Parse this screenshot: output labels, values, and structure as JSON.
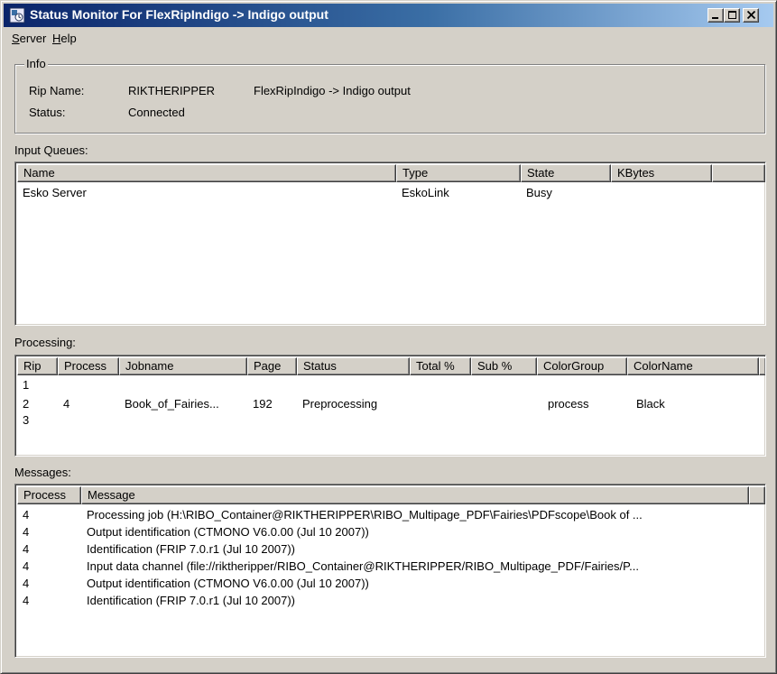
{
  "window": {
    "title": "Status Monitor For FlexRipIndigo -> Indigo output"
  },
  "menu": {
    "server": "Server",
    "server_rest": "erver",
    "server_key": "S",
    "help": "Help",
    "help_key": "H",
    "help_rest": "elp"
  },
  "info": {
    "legend": "Info",
    "rip_name_label": "Rip Name:",
    "rip_name_value": "RIKTHERIPPER",
    "rip_desc": "FlexRipIndigo -> Indigo output",
    "status_label": "Status:",
    "status_value": "Connected"
  },
  "input_queues": {
    "label": "Input Queues:",
    "columns": [
      "Name",
      "Type",
      "State",
      "KBytes"
    ],
    "rows": [
      [
        "Esko Server",
        "EskoLink",
        "Busy",
        ""
      ]
    ]
  },
  "processing": {
    "label": "Processing:",
    "columns": [
      "Rip",
      "Process",
      "Jobname",
      "Page",
      "Status",
      "Total %",
      "Sub %",
      "ColorGroup",
      "ColorName"
    ],
    "rows": [
      [
        "1",
        "",
        "",
        "",
        "",
        "",
        "",
        "",
        ""
      ],
      [
        "2",
        "4",
        "Book_of_Fairies...",
        "192",
        "Preprocessing",
        "",
        "",
        "process",
        "Black"
      ],
      [
        "3",
        "",
        "",
        "",
        "",
        "",
        "",
        "",
        ""
      ]
    ]
  },
  "messages": {
    "label": "Messages:",
    "columns": [
      "Process",
      "Message"
    ],
    "rows": [
      [
        "4",
        "Processing job (H:\\RIBO_Container@RIKTHERIPPER\\RIBO_Multipage_PDF\\Fairies\\PDFscope\\Book of ..."
      ],
      [
        "4",
        "Output identification (CTMONO V6.0.00 (Jul 10 2007))"
      ],
      [
        "4",
        "Identification (FRIP 7.0.r1 (Jul 10 2007))"
      ],
      [
        "4",
        "Input data channel (file://riktheripper/RIBO_Container@RIKTHERIPPER/RIBO_Multipage_PDF/Fairies/P..."
      ],
      [
        "4",
        "Output identification (CTMONO V6.0.00 (Jul 10 2007))"
      ],
      [
        "4",
        "Identification (FRIP 7.0.r1 (Jul 10 2007))"
      ]
    ]
  }
}
